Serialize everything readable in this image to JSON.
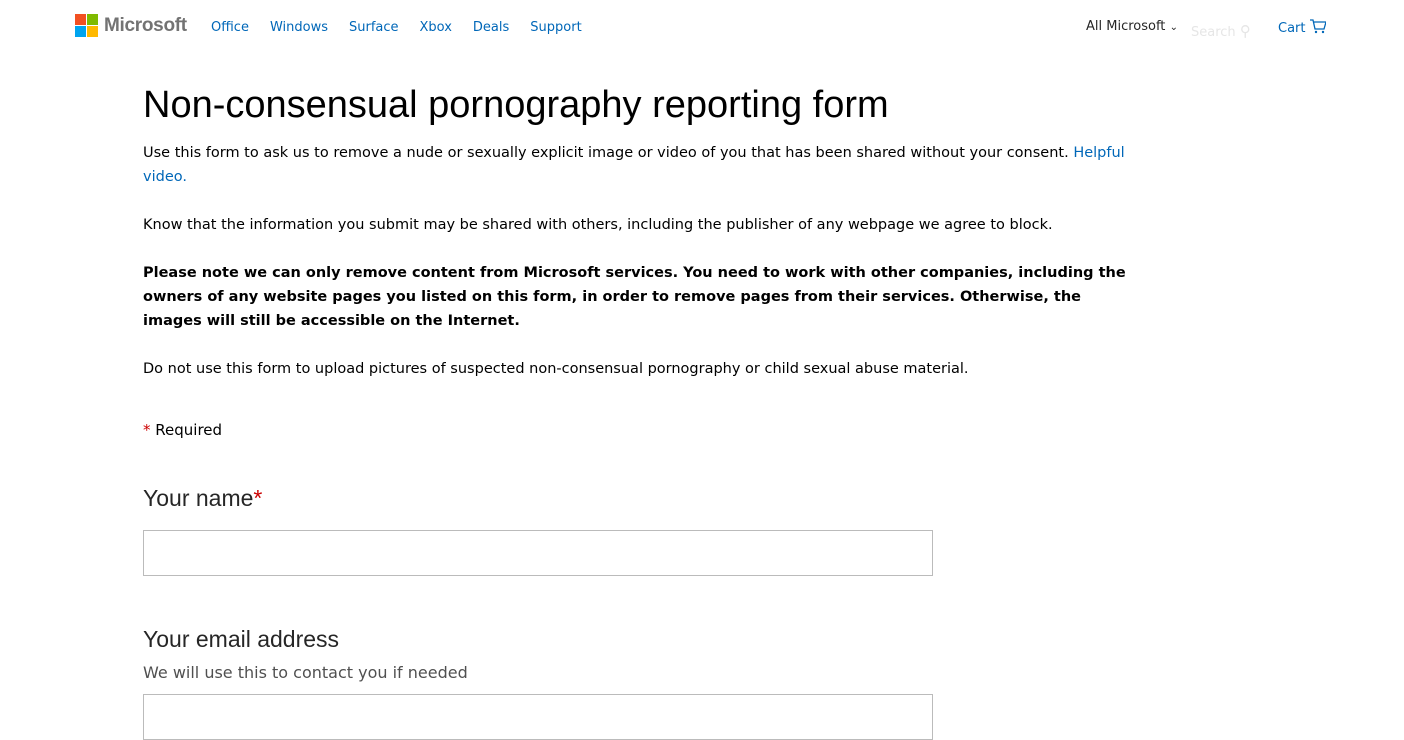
{
  "header": {
    "brand": "Microsoft",
    "nav": [
      "Office",
      "Windows",
      "Surface",
      "Xbox",
      "Deals",
      "Support"
    ],
    "all_microsoft": "All Microsoft",
    "search_placeholder": "Search",
    "cart": "Cart"
  },
  "main": {
    "title": "Non-consensual pornography reporting form",
    "intro": "Use this form to ask us to remove a nude or sexually explicit image or video of you that has been shared without your consent.",
    "intro_link": "Helpful video.",
    "p2": "Know that the information you submit may be shared with others, including the publisher of any webpage we agree to block.",
    "p3": "Please note we can only remove content from Microsoft services. You need to work with other companies, including the owners of any website pages you listed on this form, in order to remove pages from their services. Otherwise, the images will still be accessible on the Internet.",
    "p4": "Do not use this form to upload pictures of suspected non-consensual pornography or child sexual abuse material.",
    "required_mark": "*",
    "required": "Required",
    "name_label": "Your name",
    "email_label": "Your email address",
    "email_hint": "We will use this to contact you if needed"
  },
  "colors": {
    "link": "#0067b8",
    "required": "#cc0000"
  }
}
